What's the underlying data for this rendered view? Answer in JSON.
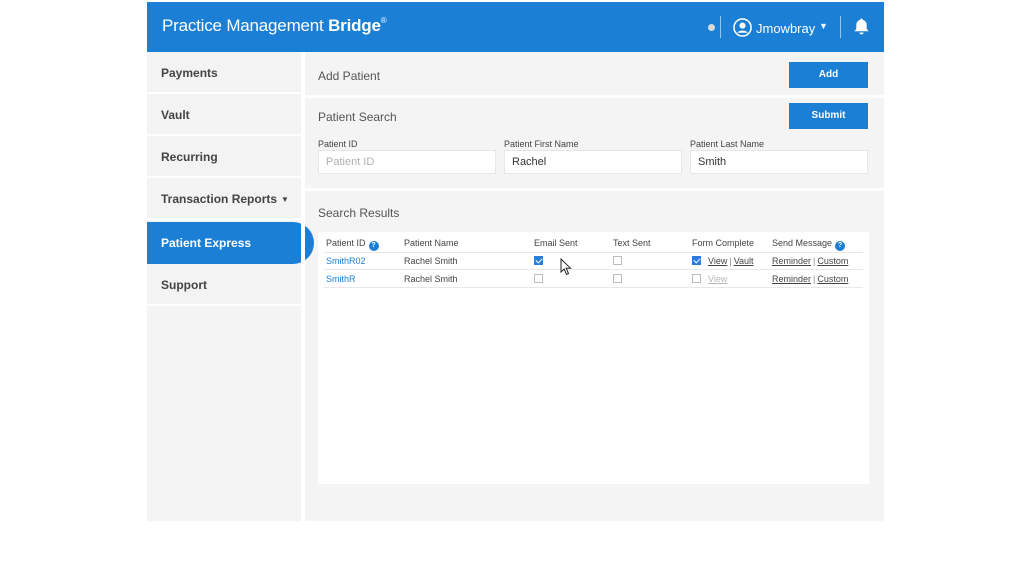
{
  "header": {
    "brand_light": "Practice Management",
    "brand_bold": "Bridge",
    "brand_tm": "®",
    "user_name": "Jmowbray"
  },
  "sidebar": {
    "items": [
      {
        "label": "Payments"
      },
      {
        "label": "Vault"
      },
      {
        "label": "Recurring"
      },
      {
        "label": "Transaction Reports"
      },
      {
        "label": "Patient Express",
        "active": true
      },
      {
        "label": "Support"
      }
    ]
  },
  "add_patient": {
    "title": "Add Patient",
    "button": "Add"
  },
  "patient_search": {
    "title": "Patient Search",
    "button": "Submit",
    "fields": {
      "patient_id": {
        "label": "Patient ID",
        "placeholder": "Patient ID",
        "value": ""
      },
      "first_name": {
        "label": "Patient First Name",
        "value": "Rachel"
      },
      "last_name": {
        "label": "Patient Last Name",
        "value": "Smith"
      }
    }
  },
  "results": {
    "title": "Search Results",
    "columns": {
      "patient_id": "Patient ID",
      "patient_name": "Patient Name",
      "email_sent": "Email Sent",
      "text_sent": "Text Sent",
      "form_complete": "Form Complete",
      "send_message": "Send Message"
    },
    "help_glyph": "?",
    "rows": [
      {
        "patient_id": "SmithR02",
        "patient_name": "Rachel Smith",
        "email_sent": true,
        "text_sent": false,
        "form_complete": true,
        "view": "View",
        "vault": "Vault",
        "reminder": "Reminder",
        "custom": "Custom"
      },
      {
        "patient_id": "SmithR",
        "patient_name": "Rachel Smith",
        "email_sent": false,
        "text_sent": false,
        "form_complete": false,
        "view": "View",
        "reminder": "Reminder",
        "custom": "Custom"
      }
    ],
    "separator": "|"
  },
  "colors": {
    "brand_blue": "#1b7fd6",
    "background": "#f4f4f4"
  }
}
